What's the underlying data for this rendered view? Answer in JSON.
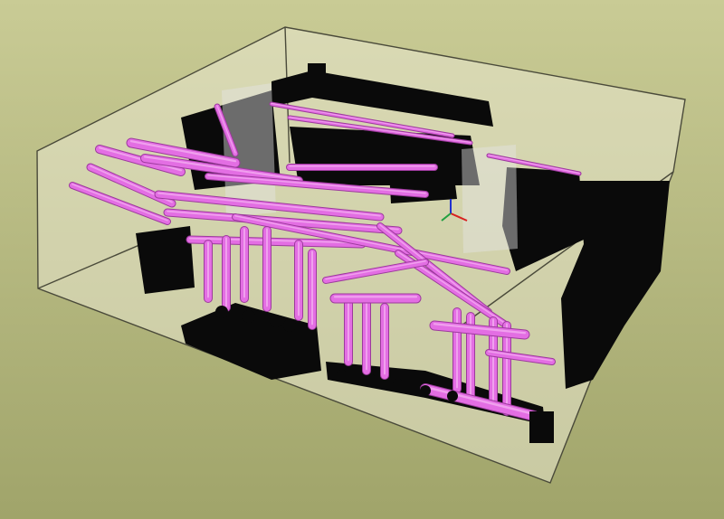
{
  "viewport": {
    "background_top": "#c9cb95",
    "background_bottom": "#a0a46a"
  },
  "scene": {
    "room_fill": "#e9e7cf",
    "room_edge": "#4a4a3a",
    "pipe_color": "#e36ee3",
    "pipe_highlight": "#f6b6f4",
    "pipe_shadow": "#9c3a9c",
    "equipment_color": "#0a0a0a",
    "frame_color": "#e4e4e4",
    "axis_colors": [
      "#d82020",
      "#2030d0",
      "#20a040"
    ]
  }
}
